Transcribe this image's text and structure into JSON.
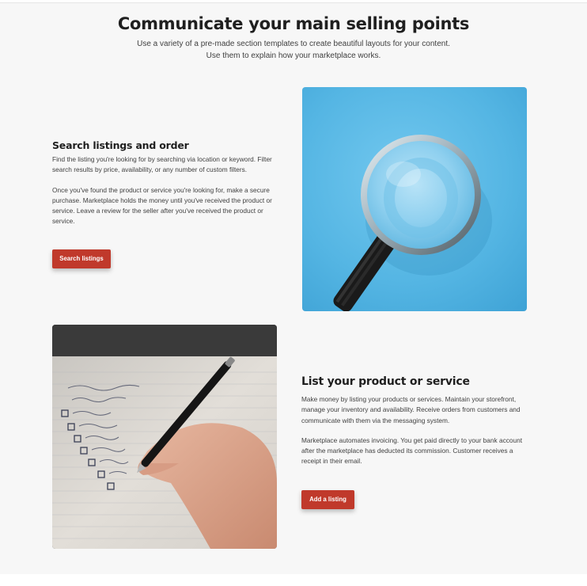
{
  "section": {
    "heading": "Communicate your main selling points",
    "subheading": "Use a variety of a pre-made section templates to create beautiful layouts for your content. Use them to explain how your marketplace works."
  },
  "blocks": [
    {
      "title": "Search listings and order",
      "paragraphs": [
        "Find the listing you're looking for by searching via location or keyword. Filter search results by price, availability, or any number of custom filters.",
        "Once you've found the product or service you're looking for, make a secure purchase. Marketplace holds the money until you've received the product or service. Leave a review for the seller after you've received the product or service."
      ],
      "button_label": "Search listings",
      "image": "magnifying-glass-icon"
    },
    {
      "title": "List your product or service",
      "paragraphs": [
        "Make money by listing your products or services. Maintain your storefront, manage your inventory and availability. Receive orders from customers and communicate with them via the messaging system.",
        "Marketplace automates invoicing. You get paid directly to your bank account after the marketplace has deducted its commission. Customer receives a receipt in their email."
      ],
      "button_label": "Add a listing",
      "image": "checklist-icon"
    }
  ],
  "colors": {
    "accent": "#c0392b",
    "background": "#f7f7f7",
    "heading": "#1f1f1f",
    "text": "#3f3f3f",
    "image_blue": "#52b2e0"
  }
}
